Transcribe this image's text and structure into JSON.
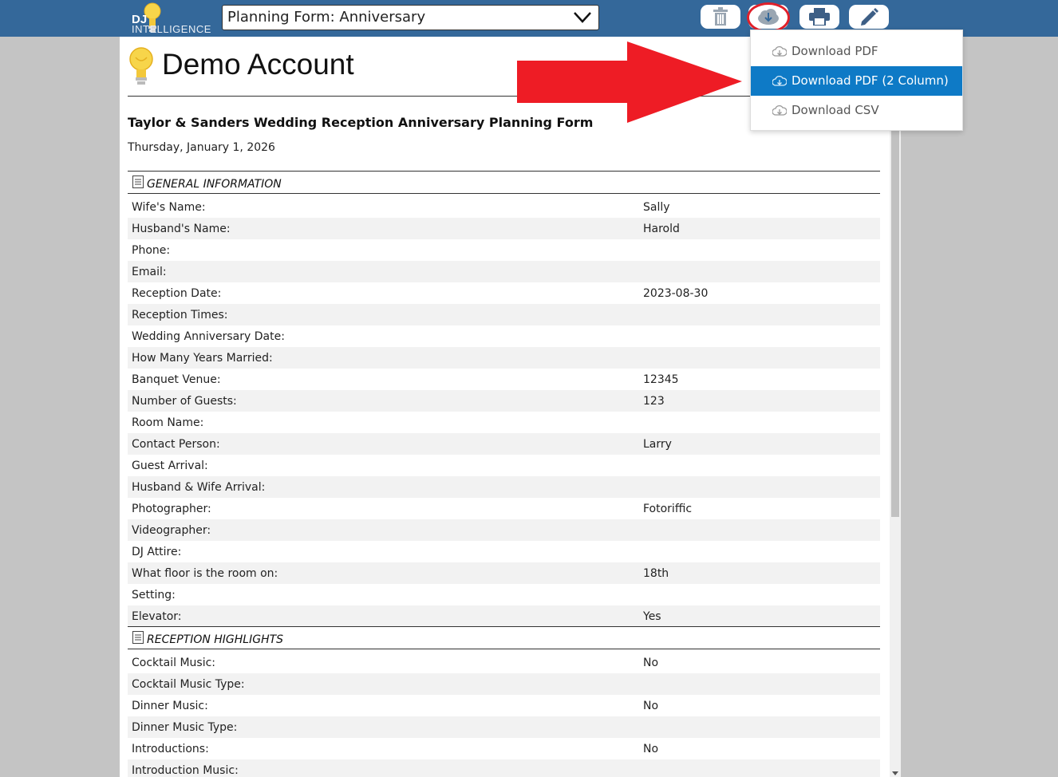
{
  "header": {
    "logo_dj": "DJ",
    "logo_intelligence": "INTELLIGENCE",
    "form_selector_value": "Planning Form: Anniversary"
  },
  "toolbar": {
    "buttons": [
      "trash-icon",
      "cloud-download-icon",
      "print-icon",
      "edit-icon"
    ]
  },
  "download_menu": {
    "items": [
      "Download PDF",
      "Download PDF (2 Column)",
      "Download CSV"
    ],
    "active_index": 1
  },
  "account": {
    "title": "Demo Account"
  },
  "event": {
    "title": "Taylor & Sanders Wedding Reception Anniversary Planning Form",
    "date": "Thursday, January 1, 2026"
  },
  "sections": [
    {
      "label": "GENERAL INFORMATION",
      "rows": [
        {
          "label": "Wife's Name:",
          "value": "Sally"
        },
        {
          "label": "Husband's Name:",
          "value": "Harold"
        },
        {
          "label": "Phone:",
          "value": ""
        },
        {
          "label": "Email:",
          "value": ""
        },
        {
          "label": "Reception Date:",
          "value": "2023-08-30"
        },
        {
          "label": "Reception Times:",
          "value": ""
        },
        {
          "label": "Wedding Anniversary Date:",
          "value": ""
        },
        {
          "label": "How Many Years Married:",
          "value": ""
        },
        {
          "label": "Banquet Venue:",
          "value": "12345"
        },
        {
          "label": "Number of Guests:",
          "value": "123"
        },
        {
          "label": "Room Name:",
          "value": ""
        },
        {
          "label": "Contact Person:",
          "value": "Larry"
        },
        {
          "label": "Guest Arrival:",
          "value": ""
        },
        {
          "label": "Husband & Wife Arrival:",
          "value": ""
        },
        {
          "label": "Photographer:",
          "value": "Fotoriffic"
        },
        {
          "label": "Videographer:",
          "value": ""
        },
        {
          "label": "DJ Attire:",
          "value": ""
        },
        {
          "label": "What floor is the room on:",
          "value": "18th"
        },
        {
          "label": "Setting:",
          "value": ""
        },
        {
          "label": "Elevator:",
          "value": "Yes"
        }
      ]
    },
    {
      "label": "RECEPTION HIGHLIGHTS",
      "rows": [
        {
          "label": "Cocktail Music:",
          "value": "No"
        },
        {
          "label": "Cocktail Music Type:",
          "value": ""
        },
        {
          "label": "Dinner Music:",
          "value": "No"
        },
        {
          "label": "Dinner Music Type:",
          "value": ""
        },
        {
          "label": "Introductions:",
          "value": "No"
        },
        {
          "label": "Introduction Music:",
          "value": ""
        }
      ]
    }
  ],
  "colors": {
    "header_bg": "#34689a",
    "active_menu": "#0e7ac6",
    "annotation_red": "#e0202a"
  }
}
